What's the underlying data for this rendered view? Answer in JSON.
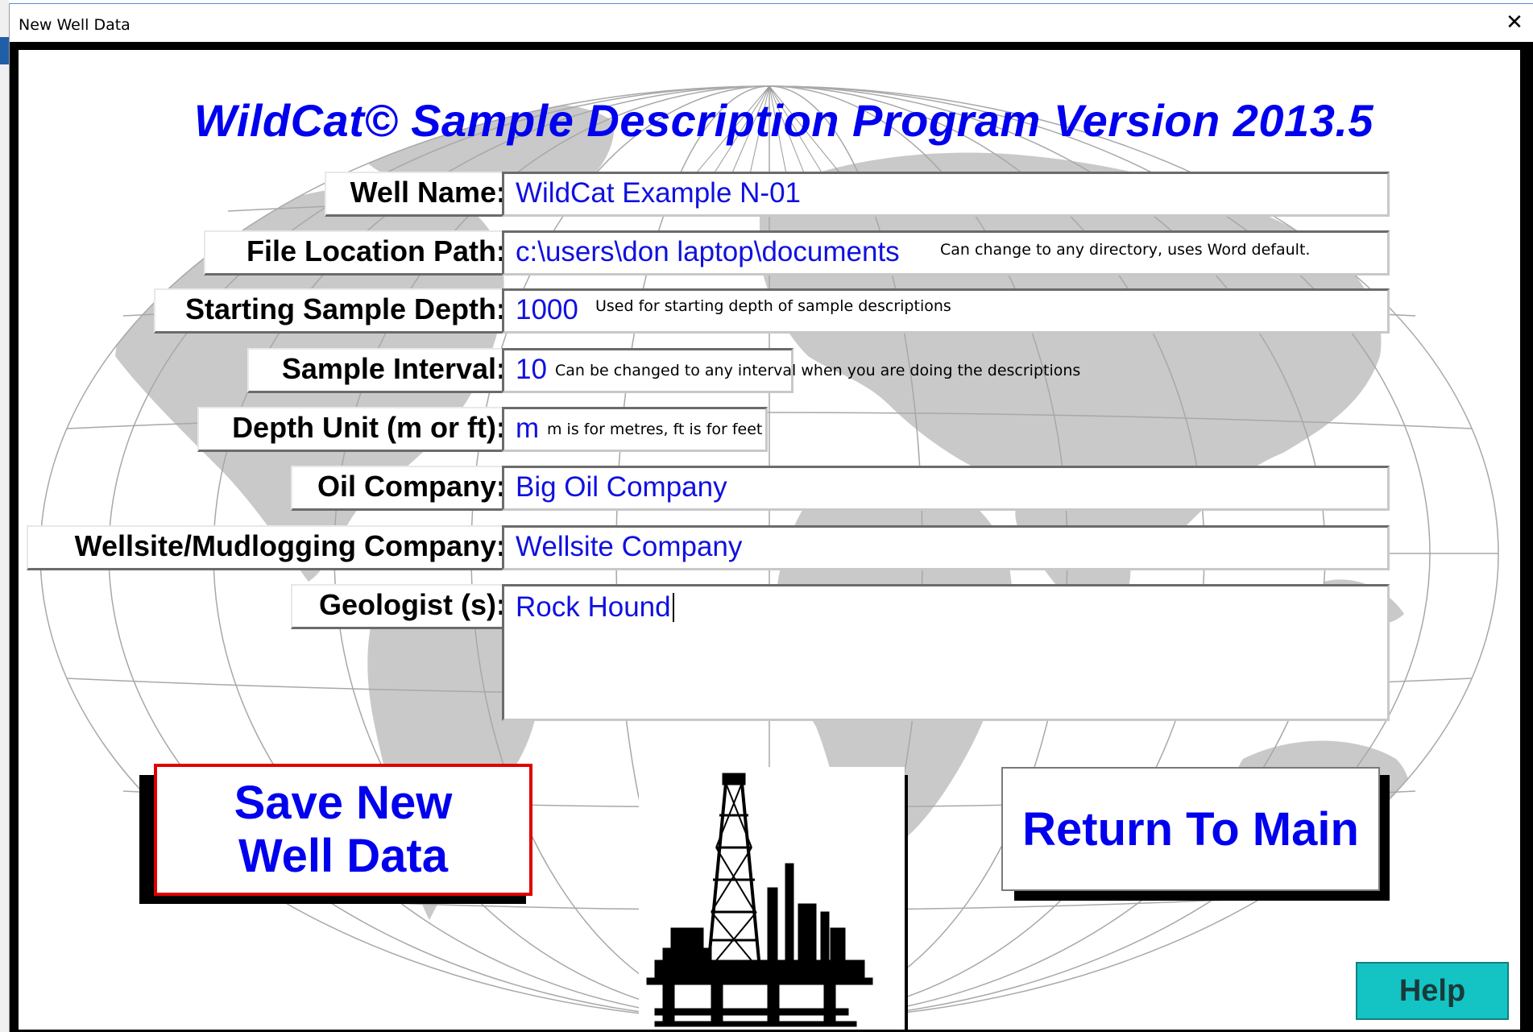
{
  "window": {
    "title": "New Well Data",
    "close_glyph": "✕"
  },
  "app_title": "WildCat© Sample Description Program Version 2013.5",
  "fields": {
    "well_name": {
      "label": "Well Name:",
      "value": "WildCat Example N-01"
    },
    "file_location": {
      "label": "File Location Path:",
      "value": "c:\\users\\don laptop\\documents",
      "note": "Can change to any directory, uses Word default."
    },
    "start_depth": {
      "label": "Starting Sample Depth:",
      "value": "1000",
      "note": "Used for starting depth of sample descriptions"
    },
    "sample_interval": {
      "label": "Sample Interval:",
      "value": "10",
      "note": "Can be changed to any interval when you are doing the descriptions"
    },
    "depth_unit": {
      "label": "Depth Unit (m or ft):",
      "value": "m",
      "note": "m is for metres, ft is for feet"
    },
    "oil_company": {
      "label": "Oil Company:",
      "value": "Big Oil Company"
    },
    "wellsite_company": {
      "label": "Wellsite/Mudlogging Company:",
      "value": "Wellsite Company"
    },
    "geologist": {
      "label": "Geologist (s):",
      "value": "Rock Hound"
    }
  },
  "buttons": {
    "save": "Save New Well Data",
    "return_main": "Return To Main",
    "help": "Help"
  },
  "icons": {
    "close": "close-icon",
    "rig": "oil-rig-icon",
    "globe": "world-map-background"
  },
  "colors": {
    "title_blue": "#0000ee",
    "value_blue": "#1010e0",
    "focus_red": "#e00000",
    "help_teal": "#14c4c4",
    "globe_gray": "#c9c9c9"
  }
}
